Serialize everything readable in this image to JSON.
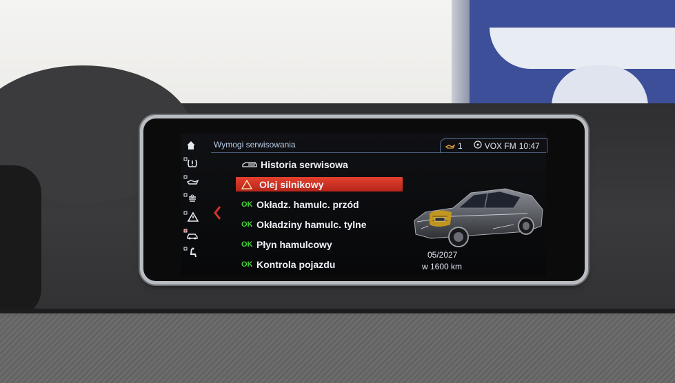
{
  "header": {
    "title": "Wymogi serwisowania",
    "status": {
      "notification_count": "1",
      "radio": "VOX FM",
      "time": "10:47"
    }
  },
  "side_icons": [
    "home-icon",
    "tire-pressure-icon",
    "oil-level-icon",
    "service-icon",
    "warning-triangle-icon",
    "car-settings-icon",
    "seat-icon"
  ],
  "menu": {
    "items": [
      {
        "tag": "hist",
        "label": "Historia serwisowa"
      },
      {
        "tag": "warn",
        "label": "Olej silnikowy",
        "selected": true
      },
      {
        "tag": "ok",
        "tag_text": "OK",
        "label": "Okładz. hamulc. przód"
      },
      {
        "tag": "ok",
        "tag_text": "OK",
        "label": "Okładziny hamulc. tylne"
      },
      {
        "tag": "ok",
        "tag_text": "OK",
        "label": "Płyn hamulcowy"
      },
      {
        "tag": "ok",
        "tag_text": "OK",
        "label": "Kontrola pojazdu"
      }
    ]
  },
  "detail": {
    "due_date": "05/2027",
    "due_distance": "w 1600 km"
  },
  "colors": {
    "accent_red": "#d2362a",
    "ok_green": "#45d43a",
    "header_blue": "#b9cce8"
  }
}
